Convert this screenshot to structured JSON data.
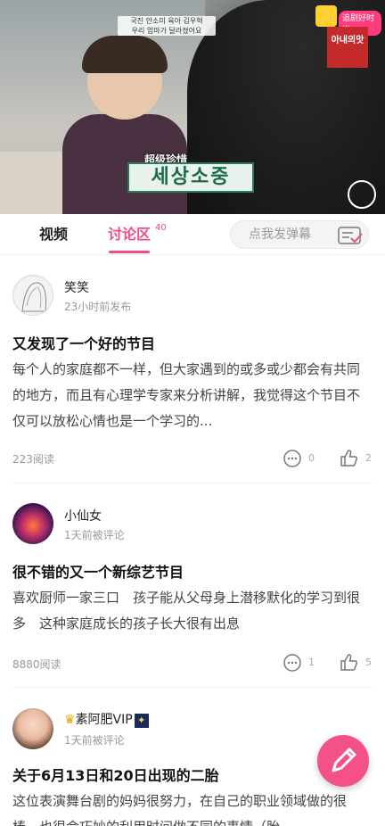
{
  "video": {
    "top_caption": "국진 안소미 육아 김우혁\n우리 엄마가 달라졌어요",
    "caption_sub": "超级珍惜",
    "caption_main": "세상소중",
    "brand_pill": "追剧好时光",
    "red_box_text": "아내의맛"
  },
  "tabs": {
    "video": "视频",
    "discussion": "讨论区",
    "discussion_count": "40"
  },
  "danmu": {
    "placeholder": "点我发弹幕"
  },
  "posts": [
    {
      "user": "笑笑",
      "meta": "23小时前发布",
      "title": "又发现了一个好的节目",
      "body": "每个人的家庭都不一样，但大家遇到的或多或少都会有共同的地方，而且有心理学专家来分析讲解，我觉得这个节目不仅可以放松心情也是一个学习的...",
      "reads": "223阅读",
      "comments": "0",
      "likes": "2"
    },
    {
      "user": "小仙女",
      "meta": "1天前被评论",
      "title": "很不错的又一个新综艺节目",
      "body": "喜欢厨师一家三口　孩子能从父母身上潜移默化的学习到很多　这种家庭成长的孩子长大很有出息",
      "reads": "8880阅读",
      "comments": "1",
      "likes": "5"
    },
    {
      "user": "素阿肥VIP",
      "meta": "1天前被评论",
      "title": "关于6月13日和20日出现的二胎",
      "body": "这位表演舞台剧的妈妈很努力，在自己的职业领域做的很棒，也很会巧妙的利用时间做不同的事情（胎",
      "reads": "",
      "comments": "",
      "likes": ""
    }
  ],
  "colors": {
    "accent": "#ef4d8a",
    "fab": "#f4508a"
  }
}
